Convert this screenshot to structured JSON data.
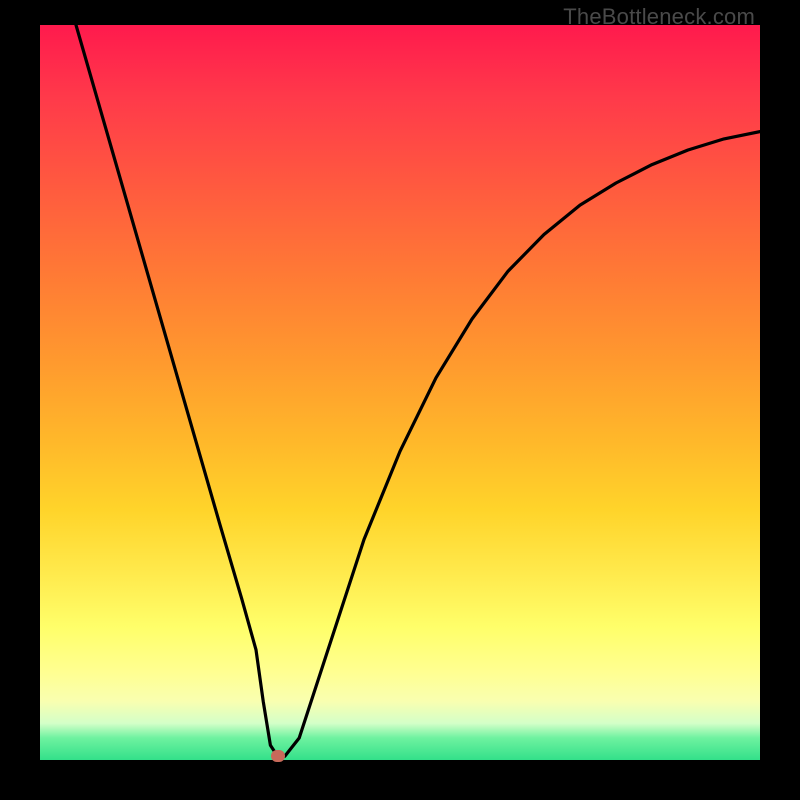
{
  "watermark": "TheBottleneck.com",
  "chart_data": {
    "type": "line",
    "title": "",
    "xlabel": "",
    "ylabel": "",
    "xlim": [
      0,
      100
    ],
    "ylim": [
      0,
      100
    ],
    "series": [
      {
        "name": "curve",
        "x": [
          5,
          10,
          15,
          20,
          25,
          28,
          30,
          31,
          32,
          33,
          34,
          36,
          40,
          45,
          50,
          55,
          60,
          65,
          70,
          75,
          80,
          85,
          90,
          95,
          100
        ],
        "y": [
          100,
          83,
          66,
          49,
          32,
          22,
          15,
          8,
          2,
          0.5,
          0.5,
          3,
          15,
          30,
          42,
          52,
          60,
          66.5,
          71.5,
          75.5,
          78.5,
          81,
          83,
          84.5,
          85.5
        ]
      }
    ],
    "marker": {
      "x": 33,
      "y": 0.5,
      "color": "#c86a5a"
    },
    "gradient_stops": [
      {
        "pos": 0.0,
        "color": "#ff1a4d"
      },
      {
        "pos": 0.5,
        "color": "#ffb92a"
      },
      {
        "pos": 0.82,
        "color": "#ffff6a"
      },
      {
        "pos": 1.0,
        "color": "#33e08a"
      }
    ]
  }
}
